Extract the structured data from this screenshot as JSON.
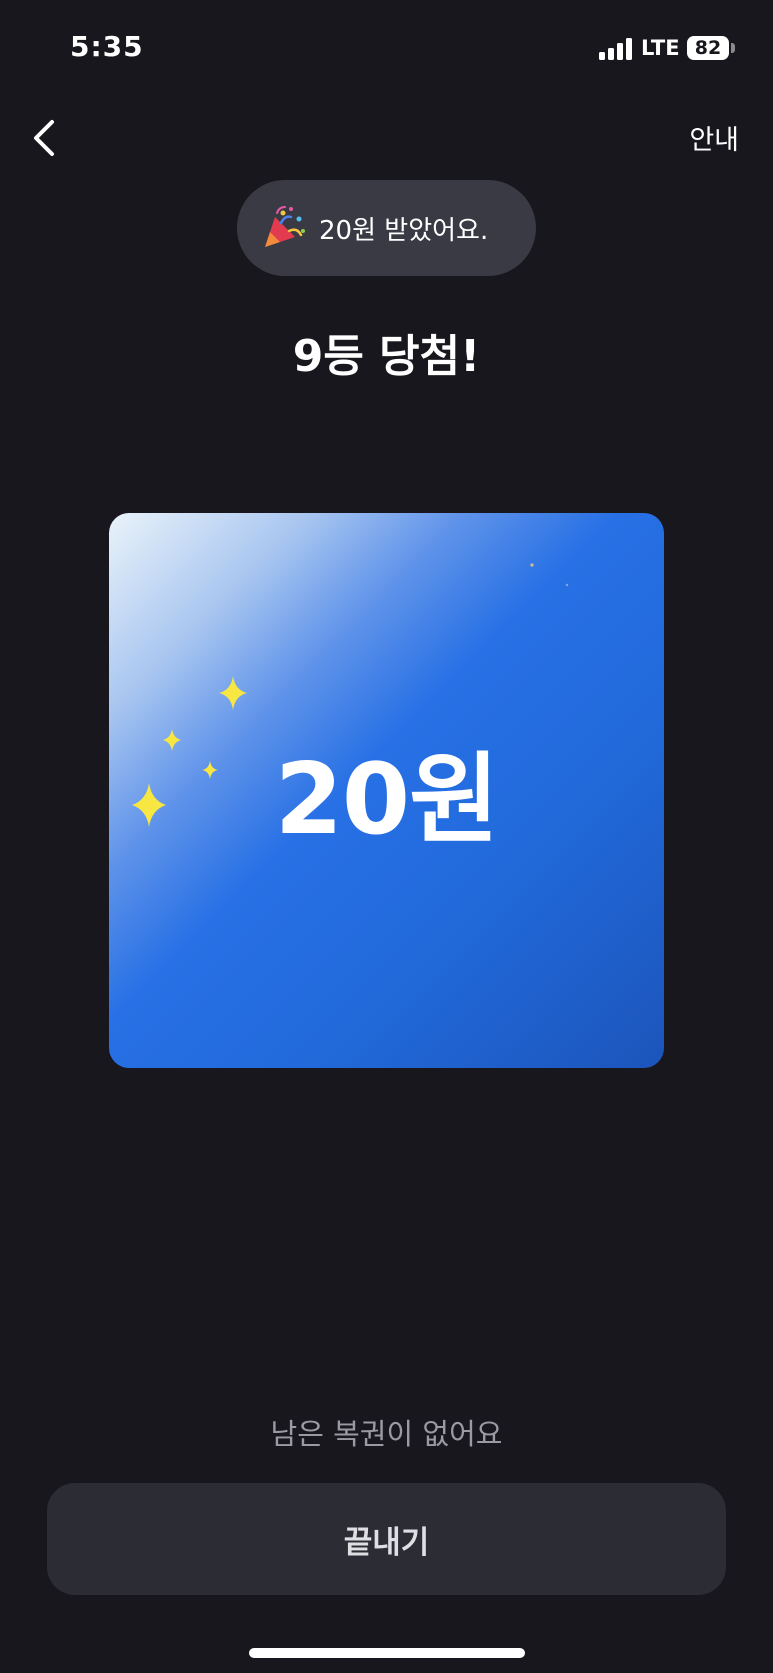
{
  "status_bar": {
    "time": "5:35",
    "network": "LTE",
    "battery": "82"
  },
  "nav": {
    "back_icon": "chevron-left-icon",
    "guide_label": "안내"
  },
  "toast": {
    "icon": "party-popper-icon",
    "text": "20원 받았어요."
  },
  "result": {
    "title": "9등 당첨!"
  },
  "prize_card": {
    "amount": "20원",
    "decoration": "sparkles-icon",
    "gradient_colors": [
      "#eaf3fa",
      "#2770e5",
      "#1c55bb"
    ]
  },
  "footer": {
    "remaining_text": "남은 복권이 없어요",
    "finish_label": "끝내기"
  },
  "colors": {
    "background": "#18171d",
    "pill": "#3a3a44",
    "button": "#2c2c35",
    "sparkle": "#f8e642"
  }
}
